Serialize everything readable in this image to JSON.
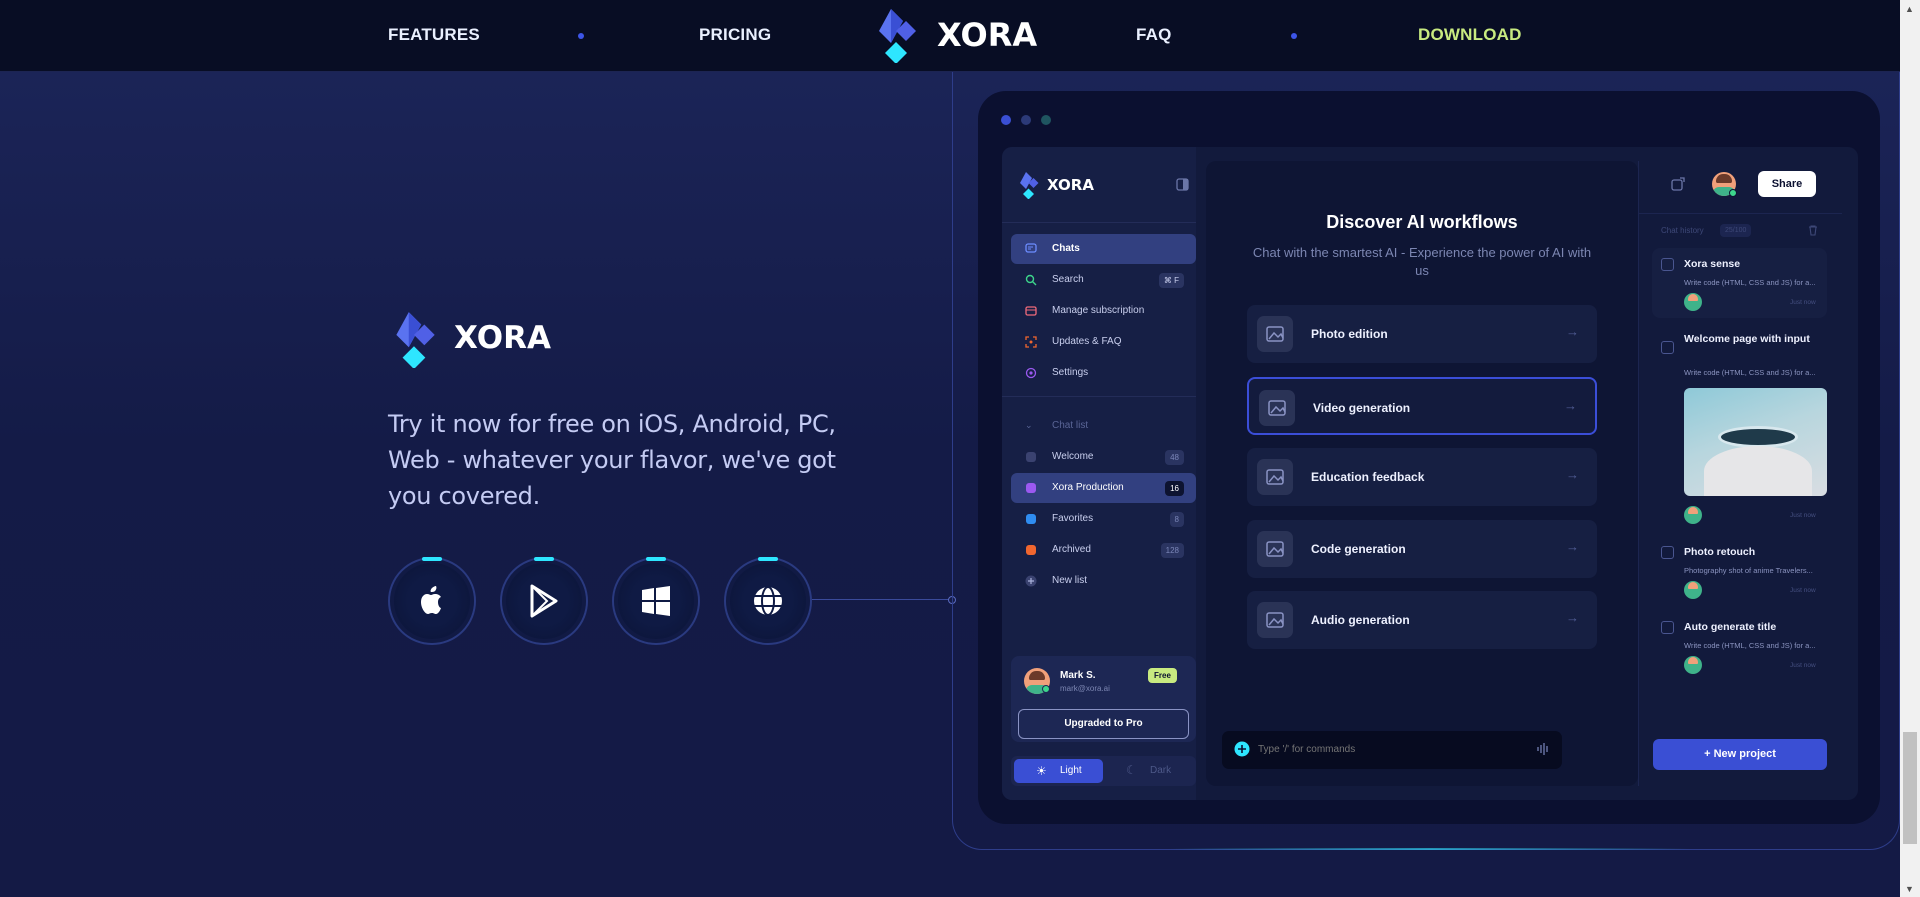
{
  "nav": {
    "features": "FEATURES",
    "pricing": "PRICING",
    "brand": "XORA",
    "faq": "FAQ",
    "download": "DOWNLOAD",
    "download_color": "#c8ea80"
  },
  "hero": {
    "brand": "XORA",
    "title": "Try it now for free on iOS, Android, PC, Web - whatever your flavor, we've got you covered.",
    "stores": [
      "apple-icon",
      "play-store-icon",
      "windows-icon",
      "web-globe-icon"
    ]
  },
  "app": {
    "brand": "XORA",
    "menu": [
      {
        "label": "Chats",
        "icon": "chat-icon"
      },
      {
        "label": "Search",
        "icon": "search-icon",
        "shortcut": "⌘ F"
      },
      {
        "label": "Manage subscription",
        "icon": "card-icon"
      },
      {
        "label": "Updates & FAQ",
        "icon": "scan-icon"
      },
      {
        "label": "Settings",
        "icon": "gear-icon"
      }
    ],
    "chat_list_label": "Chat list",
    "lists": [
      {
        "label": "Welcome",
        "count": "48",
        "color": "#3a4270"
      },
      {
        "label": "Xora Production",
        "count": "16",
        "color": "#9b59f0"
      },
      {
        "label": "Favorites",
        "count": "8",
        "color": "#2f8cf0"
      },
      {
        "label": "Archived",
        "count": "128",
        "color": "#f0662f"
      }
    ],
    "new_list": "New list",
    "user": {
      "name": "Mark S.",
      "email": "mark@xora.ai",
      "plan": "Free",
      "upgrade": "Upgraded to Pro"
    },
    "theme": {
      "light": "Light",
      "dark": "Dark"
    },
    "main": {
      "title": "Discover AI workflows",
      "subtitle": "Chat with the smartest AI - Experience the power of AI with us",
      "workflows": [
        "Photo edition",
        "Video generation",
        "Education feedback",
        "Code generation",
        "Audio generation"
      ],
      "command_placeholder": "Type '/' for commands"
    },
    "right": {
      "share": "Share",
      "history_label": "Chat history",
      "history_count": "25/100",
      "items": [
        {
          "title": "Xora sense",
          "desc": "Write code (HTML, CSS and JS) for a...",
          "time": "Just now"
        },
        {
          "title": "Welcome page with input",
          "desc": "Write code (HTML, CSS and JS) for a...",
          "time": "Just now"
        },
        {
          "title": "Photo retouch",
          "desc": "Photography shot of anime Travelers...",
          "time": "Just now"
        },
        {
          "title": "Auto generate title",
          "desc": "Write code (HTML, CSS and JS) for a...",
          "time": "Just now"
        }
      ],
      "new_project": "New project"
    }
  },
  "colors": {
    "accent": "#3a4fd4",
    "cyan": "#2ee6ff",
    "navy": "#080d24"
  }
}
